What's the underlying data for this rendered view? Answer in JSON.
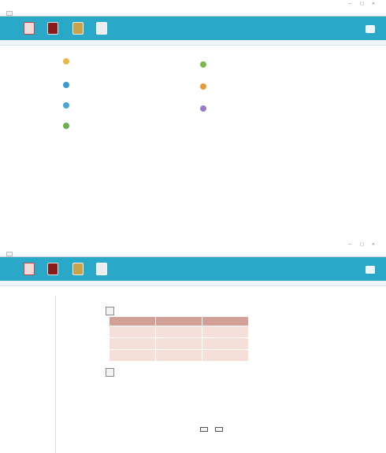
{
  "window1": {
    "title": "",
    "menu": [
      "",
      "",
      "",
      ""
    ],
    "tab": "",
    "section": "",
    "options": [
      {
        "title": "",
        "desc": ""
      },
      {
        "title": "",
        "desc": ""
      },
      {
        "title": "",
        "desc": ""
      },
      {
        "title": "",
        "desc": ""
      },
      {
        "title": "",
        "desc": ""
      },
      {
        "title": "",
        "desc": ""
      },
      {
        "title": "",
        "desc": ""
      }
    ]
  },
  "window2": {
    "title": "",
    "menu": [
      "",
      "",
      "",
      ""
    ],
    "tab": "",
    "section": "",
    "sidebar": {
      "head": "",
      "items": [
        "",
        "",
        "",
        "",
        "",
        "",
        "",
        "",
        "",
        ""
      ]
    },
    "content": {
      "title": "",
      "paragraph": "",
      "process_label": "",
      "table_headers": [
        "",
        "",
        ""
      ],
      "table_rows": [
        [
          "",
          "",
          ""
        ],
        [
          "",
          "",
          ""
        ],
        [
          "",
          "",
          ""
        ]
      ],
      "operating_label": ""
    },
    "buttons": [
      "",
      ""
    ]
  },
  "colors": {
    "banner": "#2aa8c8",
    "table_header": "#d2a097",
    "table_cell": "#f4dfd9",
    "content_title": "#c86a2a"
  },
  "icons": [
    "shield-icon",
    "book-icon",
    "tools-icon",
    "document-icon",
    "cloud-icon"
  ]
}
